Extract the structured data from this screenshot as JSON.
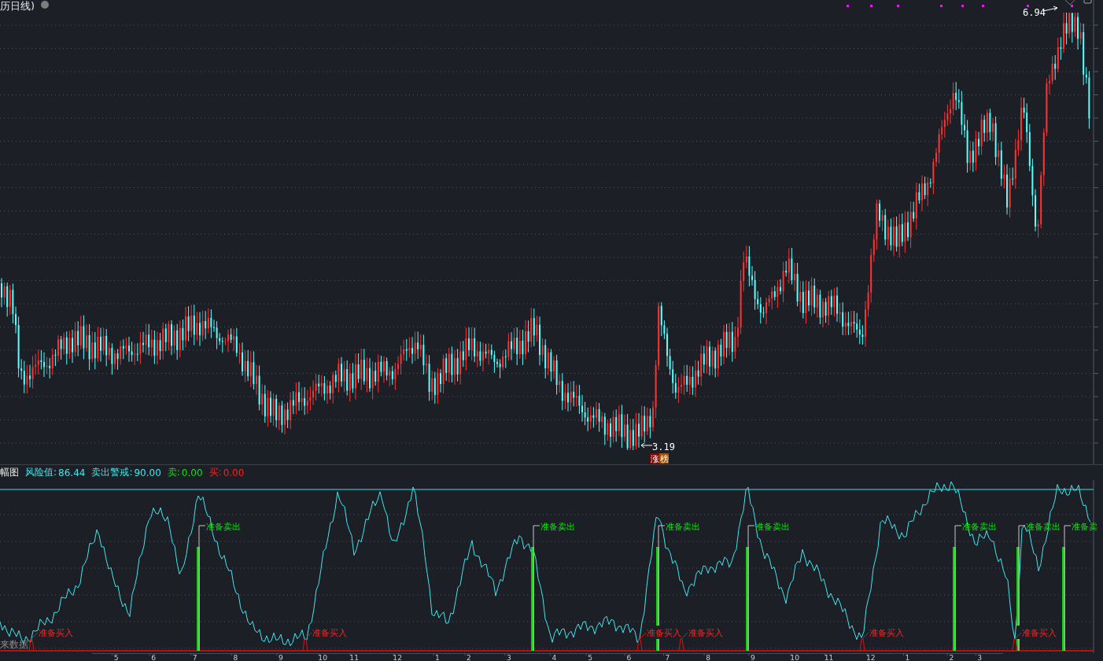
{
  "title": "历日线)",
  "price_labels": [
    {
      "kind": "high",
      "text": "6.94"
    },
    {
      "kind": "low",
      "text": "3.19"
    }
  ],
  "badge": [
    {
      "text": "涨",
      "color": "#7a0a0a"
    },
    {
      "text": "榜",
      "color": "#a0520a"
    }
  ],
  "indicator": {
    "name": "幅图",
    "readings": [
      {
        "kind": "risk",
        "label": "风险值:",
        "value": "86.44"
      },
      {
        "kind": "warn",
        "label": "卖出警戒:",
        "value": "90.00"
      },
      {
        "kind": "sell",
        "label": "卖:",
        "value": "0.00"
      },
      {
        "kind": "buy",
        "label": "买:",
        "value": "0.00"
      }
    ],
    "signals": [
      {
        "kind": "sell",
        "text": "准备卖出"
      },
      {
        "kind": "sell",
        "text": "准备卖出"
      },
      {
        "kind": "sell",
        "text": "准备卖出"
      },
      {
        "kind": "sell",
        "text": "准备卖出"
      },
      {
        "kind": "sell",
        "text": "准备卖出"
      },
      {
        "kind": "sell",
        "text": "准备卖出"
      },
      {
        "kind": "sell",
        "text": "准备卖"
      },
      {
        "kind": "buy",
        "text": "准备买入"
      },
      {
        "kind": "buy",
        "text": "准备买入"
      },
      {
        "kind": "buy",
        "text": "准备买入"
      },
      {
        "kind": "buy",
        "text": "准备买入"
      },
      {
        "kind": "buy",
        "text": "准备买入"
      },
      {
        "kind": "buy",
        "text": "准备买入"
      }
    ],
    "footer": "来数据"
  },
  "months": [
    "5",
    "6",
    "7",
    "8",
    "9",
    "10",
    "11",
    "12",
    "1",
    "2",
    "3",
    "4",
    "5",
    "6",
    "7",
    "8",
    "9",
    "10",
    "11",
    "12",
    "1",
    "2",
    "3"
  ]
}
